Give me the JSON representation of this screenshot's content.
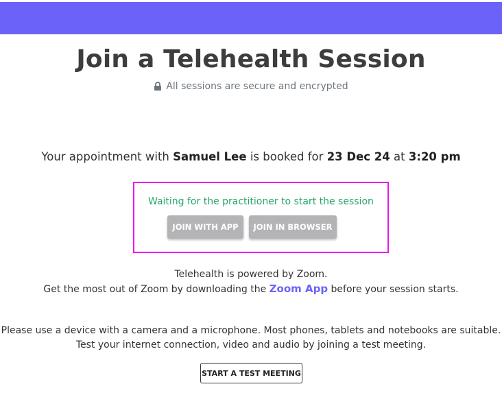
{
  "header": {
    "bar_color": "#6b63f9"
  },
  "page_title": "Join a Telehealth Session",
  "secure_note": {
    "icon": "lock-icon",
    "text": "All sessions are secure and encrypted"
  },
  "appointment": {
    "prefix": "Your appointment with ",
    "practitioner": "Samuel Lee",
    "middle": " is booked for ",
    "date": "23 Dec 24",
    "at": " at ",
    "time": "3:20 pm"
  },
  "waiting_panel": {
    "status_text": "Waiting for the practitioner to start the session",
    "join_app_label": "JOIN WITH APP",
    "join_browser_label": "JOIN IN BROWSER",
    "highlight_color": "#f012f0"
  },
  "powered": {
    "line1": "Telehealth is powered by Zoom.",
    "line2_prefix": "Get the most out of Zoom by downloading the ",
    "link_text": "Zoom App",
    "line2_suffix": " before your session starts."
  },
  "device_note": {
    "line1": "Please use a device with a camera and a microphone. Most phones, tablets and notebooks are suitable.",
    "line2": "Test your internet connection, video and audio by joining a test meeting."
  },
  "test_meeting_label": "START A TEST MEETING"
}
